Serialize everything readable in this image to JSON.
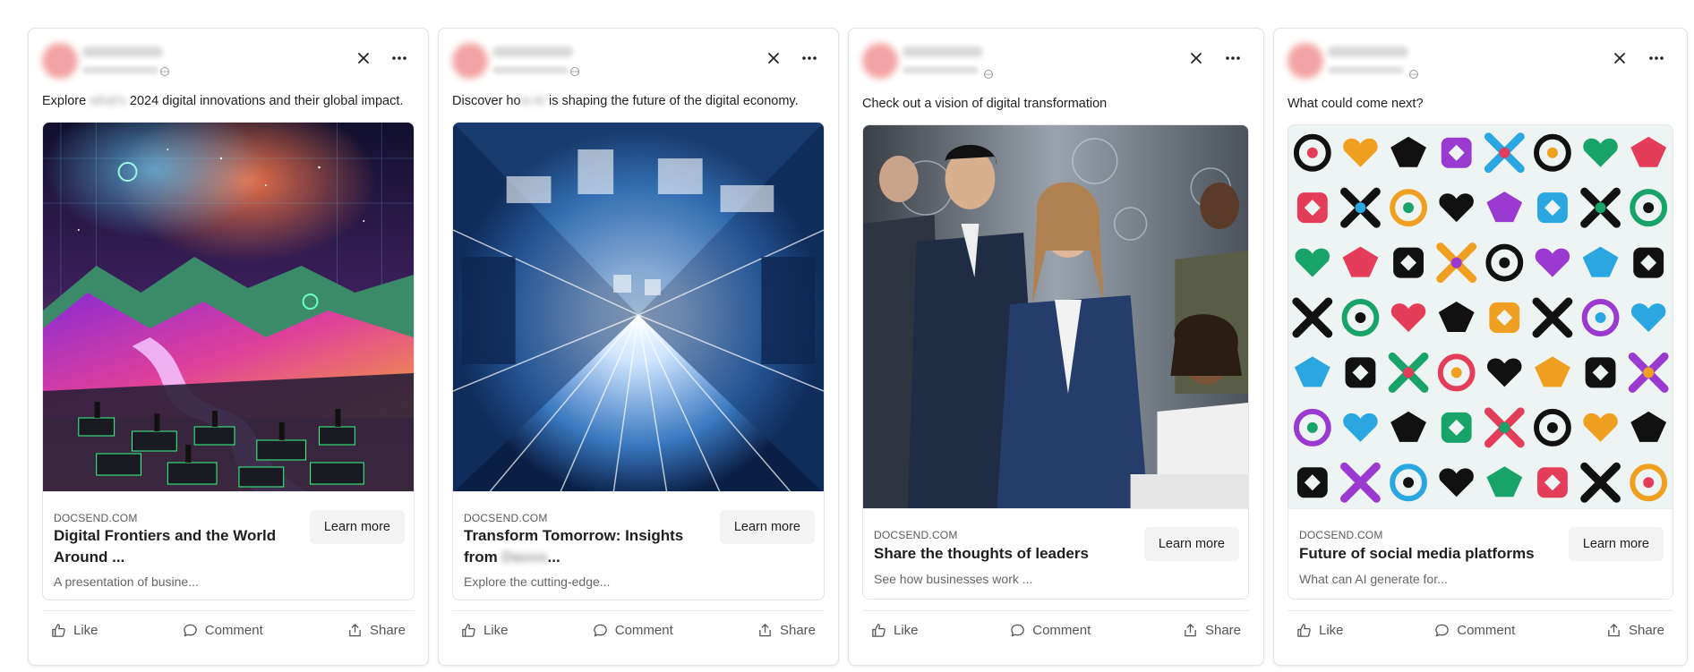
{
  "posts": [
    {
      "commentary_prefix": "Explore",
      "commentary_blurred": " what's",
      "commentary_suffix": " 2024 digital innovations and their global impact.",
      "domain": "DOCSEND.COM",
      "title_line1": "Digital Frontiers and the World",
      "title_line2": "Around ...",
      "title_blurred": "",
      "description": "A presentation of busine...",
      "cta": "Learn more"
    },
    {
      "commentary_prefix": "Discover ho",
      "commentary_blurred": "w AI",
      "commentary_suffix": " is shaping the future of the digital economy.",
      "domain": "DOCSEND.COM",
      "title_line1": "Transform Tomorrow: Insights",
      "title_line2_prefix": "from",
      "title_blurred": " Davos",
      "title_line2_suffix": "...",
      "description": "Explore the cutting-edge...",
      "cta": "Learn more"
    },
    {
      "commentary_prefix": "Check out a vision of",
      "commentary_blurred": "",
      "commentary_suffix": " digital transformation",
      "domain": "DOCSEND.COM",
      "title_line1": "Share the thoughts of leaders",
      "description": "See how businesses work ...",
      "cta": "Learn more"
    },
    {
      "commentary_prefix": "What could come next?",
      "commentary_blurred": "",
      "commentary_suffix": "",
      "domain": "DOCSEND.COM",
      "title_line1": "Future of social media platforms",
      "description": "What can AI generate for...",
      "cta": "Learn more"
    }
  ],
  "actions": {
    "like": "Like",
    "comment": "Comment",
    "share": "Share"
  },
  "icons": {
    "close": "close-icon",
    "more": "more-horizontal-icon",
    "globe": "globe-icon",
    "like": "thumbs-up-icon",
    "comment": "comment-bubble-icon",
    "share": "share-icon"
  },
  "colors": {
    "card_border": "#e3e3e3",
    "button_bg": "#f3f3f3",
    "text_primary": "#1f1f1f",
    "text_secondary": "#666666"
  }
}
